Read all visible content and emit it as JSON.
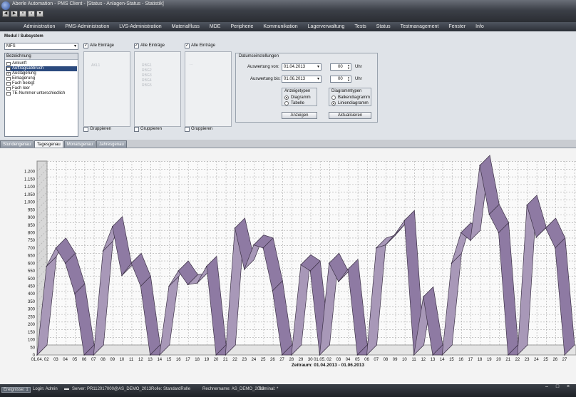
{
  "window": {
    "title": "Aberle Automation - PMS Client - [Status - Anlagen-Status - Statistik]",
    "controls": [
      "–",
      "□",
      "×"
    ]
  },
  "menu": [
    "Administration",
    "PMS-Administration",
    "LVS-Administration",
    "Materialfluss",
    "MDE",
    "Peripherie",
    "Kommunikation",
    "Lagerverwaltung",
    "Tests",
    "Status",
    "Testmanagement",
    "Fenster",
    "Info"
  ],
  "filter": {
    "module_label": "Modul / Subsystem",
    "module_value": "MFS",
    "alle_eintraege": "Alle Einträge",
    "bezeichnung_header": "Bezeichnung",
    "items": [
      {
        "label": "Ankunft",
        "checked": false,
        "selected": false
      },
      {
        "label": "Auftragsabbruch",
        "checked": false,
        "selected": true
      },
      {
        "label": "Auslagerung",
        "checked": true,
        "selected": false
      },
      {
        "label": "Einlagerung",
        "checked": false,
        "selected": false
      },
      {
        "label": "Fach belegt",
        "checked": false,
        "selected": false
      },
      {
        "label": "Fach leer",
        "checked": false,
        "selected": false
      },
      {
        "label": "TE-Nummer unterschiedlich",
        "checked": false,
        "selected": false
      }
    ],
    "box2_items": [
      "AKL1"
    ],
    "box3_items": [
      "RBG1",
      "RBG2",
      "RBG3",
      "RBG4",
      "RBG5"
    ],
    "box4_items": [
      "..."
    ],
    "gruppieren": "Gruppieren"
  },
  "dates": {
    "title": "Datumseinstellungen",
    "from_label": "Auswertung von:",
    "from_value": "01.04.2013",
    "to_label": "Auswertung bis:",
    "to_value": "01.06.2013",
    "hour_from": "00",
    "hour_to": "00",
    "uhr": "Uhr",
    "anzeigetypen": "Anzeigetypen",
    "diagramm": "Diagramm",
    "tabelle": "Tabelle",
    "diagrammtypen": "Diagrammtypen",
    "balken": "Balkendiagramm",
    "linien": "Liniendiagramm",
    "anzeigen": "Anzeigen",
    "aktualisieren": "Aktualisieren"
  },
  "tabs": [
    "Stundengenau",
    "Tagesgenau",
    "Monatsgenau",
    "Jahresgenau"
  ],
  "active_tab": 1,
  "status": {
    "ereignisse": "Ereignisse: 1",
    "login": "Login: Admin",
    "server": "Server: PR112017000@AS_DEMO_2013",
    "rolle": "Rolle: StandardRolle",
    "rechner": "Rechnername: AS_DEMO_2013",
    "terminal": "Terminal: *"
  },
  "chart_data": {
    "type": "line",
    "style": "3d-ribbon",
    "color": "#8e7aa3",
    "xlabel": "Zeitraum: 01.04.2013 - 01.06.2013",
    "ylim": [
      0,
      1250
    ],
    "yticks": [
      0,
      50,
      100,
      150,
      200,
      250,
      300,
      350,
      400,
      450,
      500,
      550,
      600,
      650,
      700,
      750,
      800,
      850,
      900,
      950,
      1000,
      1050,
      1100,
      1150,
      1200
    ],
    "ytick_labels": [
      "0",
      "50",
      "100",
      "150",
      "200",
      "250",
      "300",
      "350",
      "400",
      "450",
      "500",
      "550",
      "600",
      "650",
      "700",
      "750",
      "800",
      "850",
      "900",
      "950",
      "1.000",
      "1.050",
      "1.100",
      "1.150",
      "1.200"
    ],
    "x": [
      "01.04.",
      "02",
      "03",
      "04",
      "05",
      "06",
      "07",
      "08",
      "09",
      "10",
      "11",
      "12",
      "13",
      "14",
      "15",
      "16",
      "17",
      "18",
      "19",
      "20",
      "21",
      "22",
      "23",
      "24",
      "25",
      "26",
      "27",
      "28",
      "29",
      "30",
      "01.05.",
      "02",
      "03",
      "04",
      "05",
      "06",
      "07",
      "08",
      "09",
      "10",
      "11",
      "12",
      "13",
      "14",
      "15",
      "16",
      "17",
      "18",
      "19",
      "20",
      "21",
      "22",
      "23",
      "24",
      "25",
      "26",
      "27"
    ],
    "values": [
      0,
      580,
      700,
      600,
      400,
      0,
      0,
      680,
      840,
      520,
      600,
      450,
      0,
      0,
      450,
      550,
      460,
      470,
      580,
      0,
      0,
      830,
      560,
      720,
      700,
      420,
      0,
      0,
      590,
      550,
      0,
      600,
      480,
      560,
      0,
      0,
      700,
      720,
      790,
      880,
      0,
      380,
      0,
      0,
      600,
      800,
      750,
      1240,
      920,
      800,
      0,
      0,
      980,
      770,
      830,
      700,
      0
    ]
  }
}
